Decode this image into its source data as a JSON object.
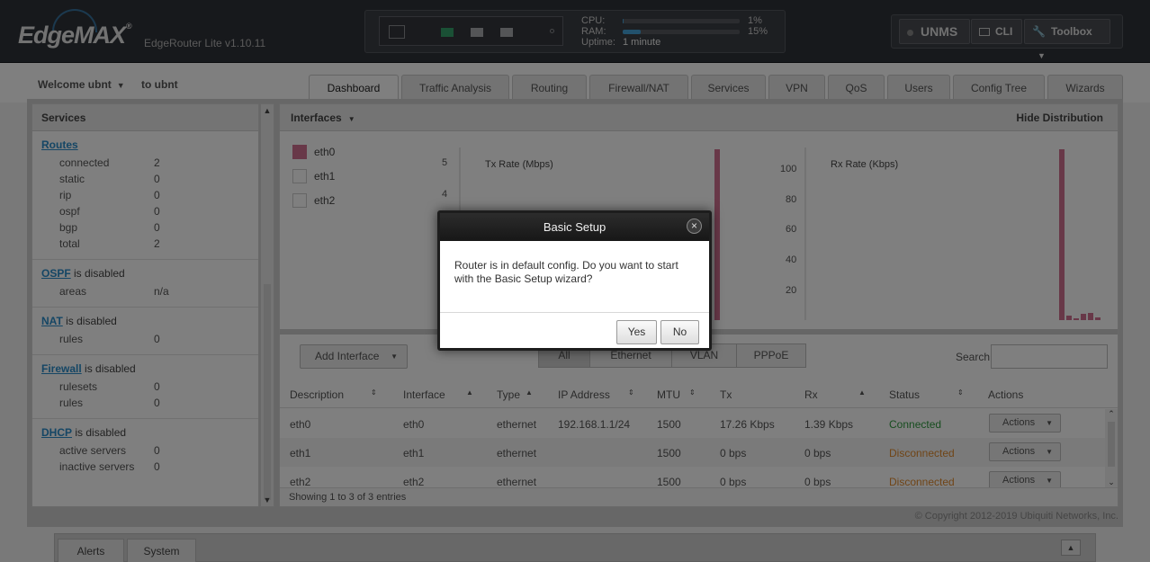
{
  "header": {
    "brand": "EdgeMAX",
    "version": "EdgeRouter Lite v1.10.11",
    "cpu_label": "CPU:",
    "cpu_value": "1%",
    "cpu_fraction": 0.01,
    "ram_label": "RAM:",
    "ram_value": "15%",
    "ram_fraction": 0.15,
    "uptime_label": "Uptime:",
    "uptime_value": "1 minute",
    "unms_label": "UNMS",
    "cli_label": "CLI",
    "toolbox_label": "Toolbox"
  },
  "user": {
    "welcome": "Welcome ubnt",
    "to": "to ubnt"
  },
  "tabs": [
    "Dashboard",
    "Traffic Analysis",
    "Routing",
    "Firewall/NAT",
    "Services",
    "VPN",
    "QoS",
    "Users",
    "Config Tree",
    "Wizards"
  ],
  "services": {
    "title": "Services",
    "routes": {
      "label": "Routes",
      "rows": [
        [
          "connected",
          "2"
        ],
        [
          "static",
          "0"
        ],
        [
          "rip",
          "0"
        ],
        [
          "ospf",
          "0"
        ],
        [
          "bgp",
          "0"
        ],
        [
          "total",
          "2"
        ]
      ]
    },
    "ospf": {
      "label": "OSPF",
      "suffix": " is disabled",
      "rows": [
        [
          "areas",
          "n/a"
        ]
      ]
    },
    "nat": {
      "label": "NAT",
      "suffix": " is disabled",
      "rows": [
        [
          "rules",
          "0"
        ]
      ]
    },
    "firewall": {
      "label": "Firewall",
      "suffix": " is disabled",
      "rows": [
        [
          "rulesets",
          "0"
        ],
        [
          "rules",
          "0"
        ]
      ]
    },
    "dhcp": {
      "label": "DHCP",
      "suffix": " is disabled",
      "rows": [
        [
          "active servers",
          "0"
        ],
        [
          "inactive servers",
          "0"
        ]
      ]
    }
  },
  "interfaces": {
    "title": "Interfaces",
    "hide_distribution": "Hide Distribution",
    "legend": [
      "eth0",
      "eth1",
      "eth2"
    ],
    "legend_colors": [
      "#d07090",
      "#ffffff",
      "#ffffff"
    ],
    "tx_chart_label": "Tx Rate (Mbps)",
    "tx_ticks": [
      "5",
      "4"
    ],
    "rx_chart_label": "Rx Rate (Kbps)",
    "rx_ticks": [
      "100",
      "80",
      "60",
      "40",
      "20"
    ],
    "bar_color": "#d07090"
  },
  "table": {
    "add_interface": "Add Interface",
    "filters": [
      "All",
      "Ethernet",
      "VLAN",
      "PPPoE"
    ],
    "search_label": "Search",
    "columns": [
      "Description",
      "Interface",
      "Type",
      "IP Address",
      "MTU",
      "Tx",
      "Rx",
      "Status",
      "Actions"
    ],
    "rows": [
      {
        "description": "eth0",
        "interface": "eth0",
        "type": "ethernet",
        "ip": "192.168.1.1/24",
        "mtu": "1500",
        "tx": "17.26 Kbps",
        "rx": "1.39 Kbps",
        "status": "Connected",
        "actions": "Actions"
      },
      {
        "description": "eth1",
        "interface": "eth1",
        "type": "ethernet",
        "ip": "",
        "mtu": "1500",
        "tx": "0 bps",
        "rx": "0 bps",
        "status": "Disconnected",
        "actions": "Actions"
      },
      {
        "description": "eth2",
        "interface": "eth2",
        "type": "ethernet",
        "ip": "",
        "mtu": "1500",
        "tx": "0 bps",
        "rx": "0 bps",
        "status": "Disconnected",
        "actions": "Actions"
      }
    ],
    "showing": "Showing 1 to 3 of 3 entries"
  },
  "copyright": "© Copyright 2012-2019 Ubiquiti Networks, Inc.",
  "dock": {
    "alerts": "Alerts",
    "system": "System"
  },
  "dialog": {
    "title": "Basic Setup",
    "message": "Router is in default config. Do you want to start with the Basic Setup wizard?",
    "yes": "Yes",
    "no": "No"
  }
}
